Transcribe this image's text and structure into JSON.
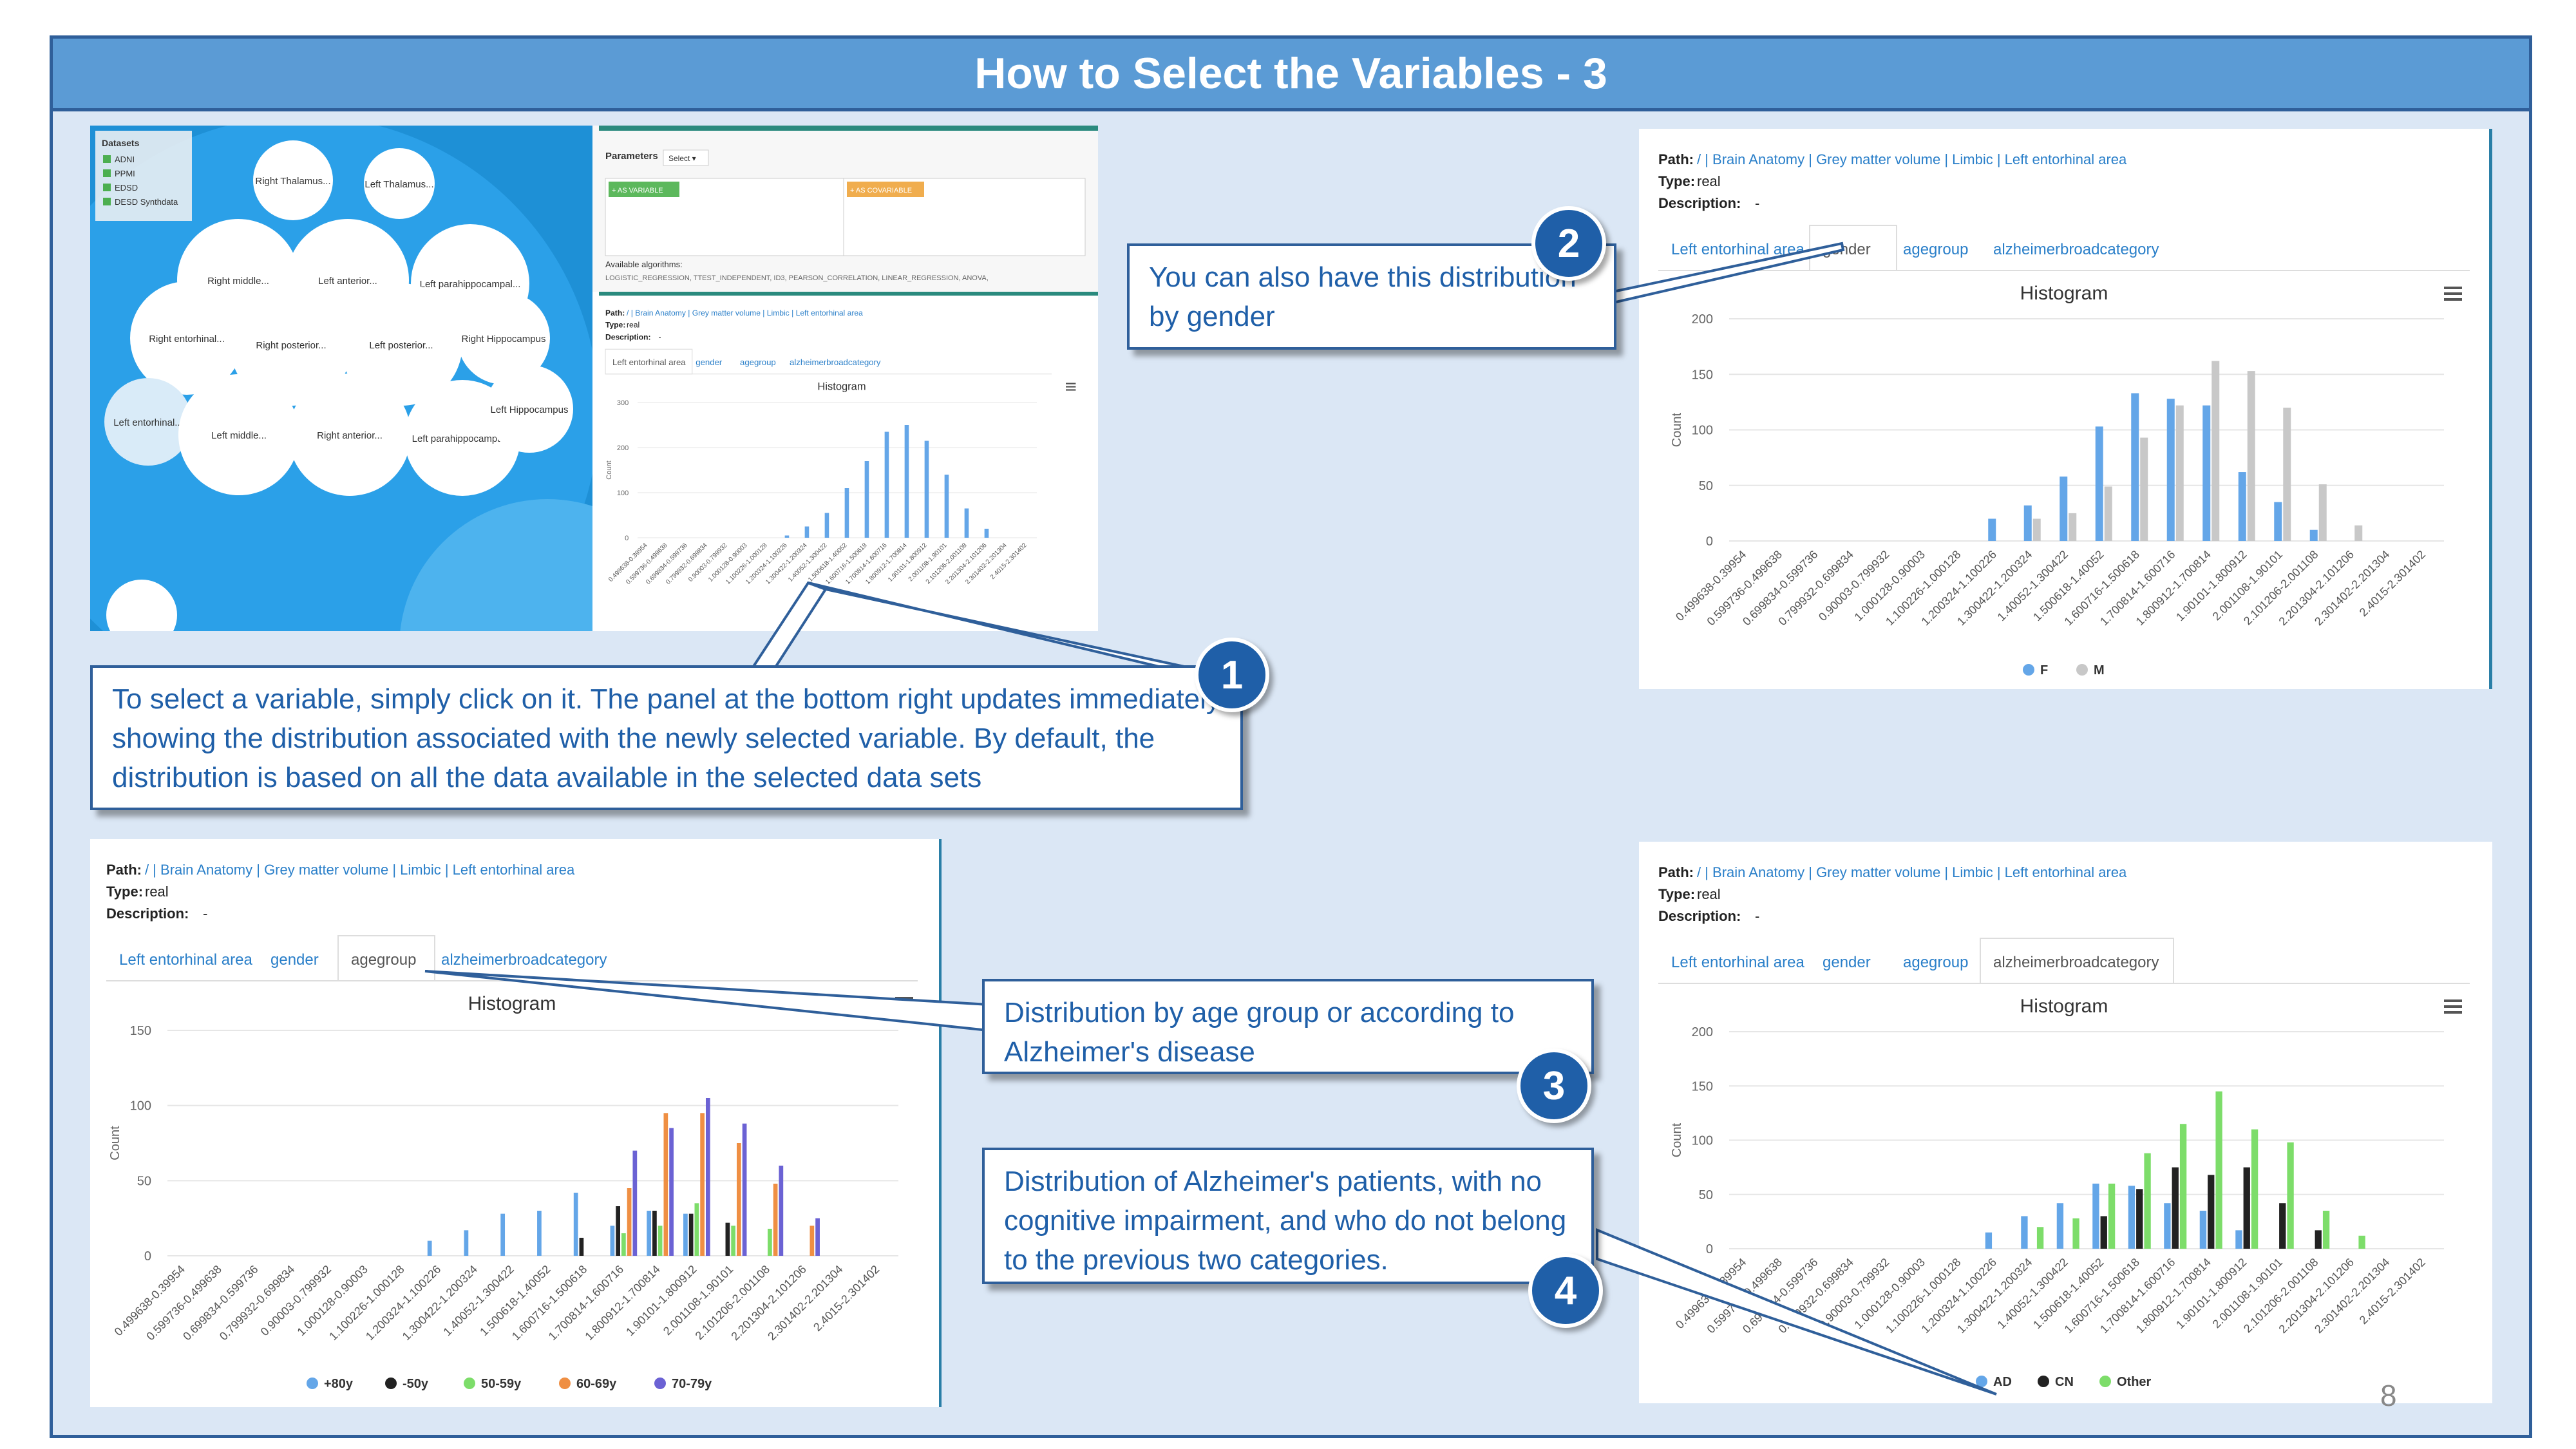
{
  "slide": {
    "title": "How to Select the Variables - 3",
    "page_number": "8"
  },
  "callouts": {
    "c1": "To select a variable, simply click on it. The panel at the bottom right updates immediately showing the distribution associated with the newly selected variable. By default, the distribution is based on all the data available in the selected data sets",
    "c2": "You can also have this distribution by gender",
    "c3": "Distribution by age group or according to Alzheimer's disease",
    "c4": "Distribution of Alzheimer's patients, with no cognitive impairment, and who do not belong to the previous two categories.",
    "b1": "1",
    "b2": "2",
    "b3": "3",
    "b4": "4"
  },
  "app": {
    "datasets_title": "Datasets",
    "datasets": [
      "ADNI",
      "PPMI",
      "EDSD",
      "DESD Synthdata"
    ],
    "bubbles": [
      "Right Thalamus...",
      "Left Thalamus...",
      "Right middle...",
      "Left anterior...",
      "Left parahippocampal...",
      "Right entorhinal...",
      "Right posterior...",
      "Left posterior...",
      "Right Hippocampus",
      "Left entorhinal...",
      "Left middle...",
      "Right anterior...",
      "Left parahippocampal...",
      "Left Hippocampus"
    ],
    "parameters_label": "Parameters",
    "select_label": "Select ▾",
    "as_variable": "+ AS VARIABLE",
    "as_covariable": "+ AS COVARIABLE",
    "available_algorithms_label": "Available algorithms:",
    "algorithms": "LOGISTIC_REGRESSION, TTEST_INDEPENDENT, ID3, PEARSON_CORRELATION, LINEAR_REGRESSION, ANOVA,"
  },
  "variable_panel": {
    "path_label": "Path:",
    "path": "/ | Brain Anatomy | Grey matter volume | Limbic | Left entorhinal area",
    "type_label": "Type:",
    "type": "real",
    "description_label": "Description:",
    "description": "-",
    "tabs": [
      "Left entorhinal area",
      "gender",
      "agegroup",
      "alzheimerbroadcategory"
    ],
    "chart_title": "Histogram",
    "menu_icon": "hamburger-menu-icon",
    "y_axis_label": "Count",
    "x_tick_labels": [
      "0.499638-0.39954",
      "0.599736-0.499638",
      "0.699834-0.599736",
      "0.799932-0.699834",
      "0.90003-0.799932",
      "1.000128-0.90003",
      "1.100226-1.000128",
      "1.200324-1.100226",
      "1.300422-1.200324",
      "1.40052-1.300422",
      "1.500618-1.40052",
      "1.600716-1.500618",
      "1.700814-1.600716",
      "1.800912-1.700814",
      "1.90101-1.800912",
      "2.001108-1.90101",
      "2.101206-2.001108",
      "2.201304-2.101206",
      "2.301402-2.201304",
      "2.4015-2.301402"
    ]
  },
  "chart_data": [
    {
      "type": "bar",
      "title": "Histogram",
      "ylabel": "Count",
      "ylim": [
        0,
        300
      ],
      "yticks": [
        "0",
        "100",
        "200",
        "300"
      ],
      "categories_ref": "variable_panel.x_tick_labels",
      "series": [
        {
          "values": [
            0,
            0,
            0,
            0,
            0,
            0,
            0,
            5,
            25,
            55,
            110,
            170,
            235,
            250,
            215,
            140,
            65,
            20,
            0,
            0
          ],
          "color": "#64a6e8"
        }
      ]
    },
    {
      "type": "bar",
      "title": "Histogram",
      "ylabel": "Count",
      "ylim": [
        0,
        200
      ],
      "yticks": [
        "0",
        "50",
        "100",
        "150",
        "200"
      ],
      "categories_ref": "variable_panel.x_tick_labels",
      "legend_position": "bottom",
      "series": [
        {
          "name": "F",
          "color": "#64a6e8",
          "values": [
            0,
            0,
            0,
            0,
            0,
            0,
            0,
            20,
            32,
            58,
            103,
            133,
            128,
            122,
            62,
            35,
            10,
            0,
            0,
            0
          ]
        },
        {
          "name": "M",
          "color": "#c8c8c8",
          "values": [
            0,
            0,
            0,
            0,
            0,
            0,
            0,
            0,
            20,
            25,
            49,
            93,
            122,
            162,
            153,
            120,
            51,
            14,
            0,
            0
          ]
        }
      ]
    },
    {
      "type": "bar",
      "title": "Histogram",
      "ylabel": "Count",
      "ylim": [
        0,
        150
      ],
      "yticks": [
        "0",
        "50",
        "100",
        "150"
      ],
      "categories_ref": "variable_panel.x_tick_labels",
      "legend_position": "bottom",
      "series": [
        {
          "name": "+80y",
          "color": "#64a6e8",
          "values": [
            0,
            0,
            0,
            0,
            0,
            0,
            0,
            10,
            17,
            28,
            30,
            42,
            20,
            30,
            28,
            0,
            0,
            0,
            0,
            0
          ]
        },
        {
          "name": "-50y",
          "color": "#222222",
          "values": [
            0,
            0,
            0,
            0,
            0,
            0,
            0,
            0,
            0,
            0,
            0,
            12,
            33,
            30,
            28,
            22,
            0,
            0,
            0,
            0
          ]
        },
        {
          "name": "50-59y",
          "color": "#7ddd6a",
          "values": [
            0,
            0,
            0,
            0,
            0,
            0,
            0,
            0,
            0,
            0,
            0,
            0,
            15,
            20,
            35,
            20,
            18,
            0,
            0,
            0
          ]
        },
        {
          "name": "60-69y",
          "color": "#ef8f43",
          "values": [
            0,
            0,
            0,
            0,
            0,
            0,
            0,
            0,
            0,
            0,
            0,
            0,
            45,
            95,
            95,
            75,
            48,
            20,
            0,
            0
          ]
        },
        {
          "name": "70-79y",
          "color": "#6b62d4",
          "values": [
            0,
            0,
            0,
            0,
            0,
            0,
            0,
            0,
            0,
            0,
            0,
            0,
            70,
            85,
            105,
            88,
            60,
            25,
            0,
            0
          ]
        }
      ]
    },
    {
      "type": "bar",
      "title": "Histogram",
      "ylabel": "Count",
      "ylim": [
        0,
        200
      ],
      "yticks": [
        "0",
        "50",
        "100",
        "150",
        "200"
      ],
      "categories_ref": "variable_panel.x_tick_labels",
      "legend_position": "bottom",
      "series": [
        {
          "name": "AD",
          "color": "#64a6e8",
          "values": [
            0,
            0,
            0,
            0,
            0,
            0,
            0,
            15,
            30,
            42,
            60,
            58,
            42,
            35,
            17,
            0,
            0,
            0,
            0,
            0
          ]
        },
        {
          "name": "CN",
          "color": "#222222",
          "values": [
            0,
            0,
            0,
            0,
            0,
            0,
            0,
            0,
            0,
            0,
            30,
            55,
            75,
            68,
            75,
            42,
            17,
            0,
            0,
            0
          ]
        },
        {
          "name": "Other",
          "color": "#7ddd6a",
          "values": [
            0,
            0,
            0,
            0,
            0,
            0,
            0,
            0,
            20,
            28,
            60,
            88,
            115,
            145,
            110,
            98,
            35,
            12,
            0,
            0
          ]
        }
      ]
    }
  ]
}
